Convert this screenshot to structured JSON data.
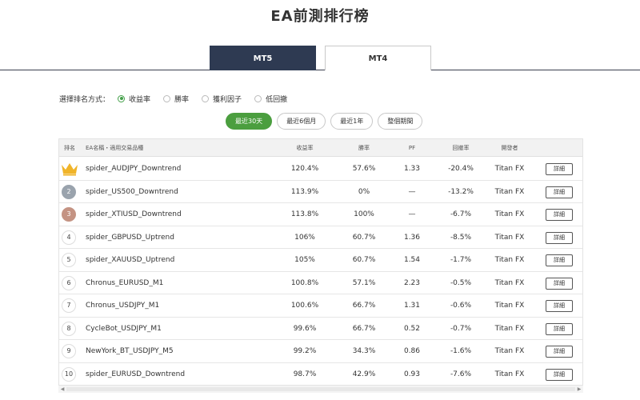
{
  "page": {
    "title": "EA前測排行榜"
  },
  "platform_tabs": [
    {
      "label": "MT5",
      "active": true
    },
    {
      "label": "MT4",
      "active": false
    }
  ],
  "sort": {
    "label": "選擇排名方式：",
    "options": [
      {
        "label": "收益率",
        "checked": true
      },
      {
        "label": "勝率",
        "checked": false
      },
      {
        "label": "獲利因子",
        "checked": false
      },
      {
        "label": "低回撤",
        "checked": false
      }
    ]
  },
  "periods": [
    {
      "label": "最近30天",
      "active": true
    },
    {
      "label": "最近6個月",
      "active": false
    },
    {
      "label": "最近1年",
      "active": false
    },
    {
      "label": "整個期間",
      "active": false
    }
  ],
  "table": {
    "headers": {
      "rank": "排名",
      "name": "EA名稱・適用交易品種",
      "return": "收益率",
      "winrate": "勝率",
      "pf": "PF",
      "drawdown": "回撤率",
      "developer": "開發者"
    },
    "rows": [
      {
        "rank": "1",
        "rank_icon": "crown-icon",
        "name": "spider_AUDJPY_Downtrend",
        "return": "120.4%",
        "winrate": "57.6%",
        "pf": "1.33",
        "drawdown": "-20.4%",
        "developer": "Titan FX",
        "detail": "詳細"
      },
      {
        "rank": "2",
        "name": "spider_US500_Downtrend",
        "return": "113.9%",
        "winrate": "0%",
        "pf": "—",
        "drawdown": "-13.2%",
        "developer": "Titan FX",
        "detail": "詳細"
      },
      {
        "rank": "3",
        "name": "spider_XTIUSD_Downtrend",
        "return": "113.8%",
        "winrate": "100%",
        "pf": "—",
        "drawdown": "-6.7%",
        "developer": "Titan FX",
        "detail": "詳細"
      },
      {
        "rank": "4",
        "name": "spider_GBPUSD_Uptrend",
        "return": "106%",
        "winrate": "60.7%",
        "pf": "1.36",
        "drawdown": "-8.5%",
        "developer": "Titan FX",
        "detail": "詳細"
      },
      {
        "rank": "5",
        "name": "spider_XAUUSD_Uptrend",
        "return": "105%",
        "winrate": "60.7%",
        "pf": "1.54",
        "drawdown": "-1.7%",
        "developer": "Titan FX",
        "detail": "詳細"
      },
      {
        "rank": "6",
        "name": "Chronus_EURUSD_M1",
        "return": "100.8%",
        "winrate": "57.1%",
        "pf": "2.23",
        "drawdown": "-0.5%",
        "developer": "Titan FX",
        "detail": "詳細"
      },
      {
        "rank": "7",
        "name": "Chronus_USDJPY_M1",
        "return": "100.6%",
        "winrate": "66.7%",
        "pf": "1.31",
        "drawdown": "-0.6%",
        "developer": "Titan FX",
        "detail": "詳細"
      },
      {
        "rank": "8",
        "name": "CycleBot_USDJPY_M1",
        "return": "99.6%",
        "winrate": "66.7%",
        "pf": "0.52",
        "drawdown": "-0.7%",
        "developer": "Titan FX",
        "detail": "詳細"
      },
      {
        "rank": "9",
        "name": "NewYork_BT_USDJPY_M5",
        "return": "99.2%",
        "winrate": "34.3%",
        "pf": "0.86",
        "drawdown": "-1.6%",
        "developer": "Titan FX",
        "detail": "詳細"
      },
      {
        "rank": "10",
        "name": "spider_EURUSD_Downtrend",
        "return": "98.7%",
        "winrate": "42.9%",
        "pf": "0.93",
        "drawdown": "-7.6%",
        "developer": "Titan FX",
        "detail": "詳細"
      }
    ]
  },
  "colors": {
    "accent_green": "#4b9e3f",
    "tab_dark": "#2e3a52",
    "gold": "#f0b429",
    "silver": "#9aa3ad",
    "bronze": "#c49383"
  }
}
